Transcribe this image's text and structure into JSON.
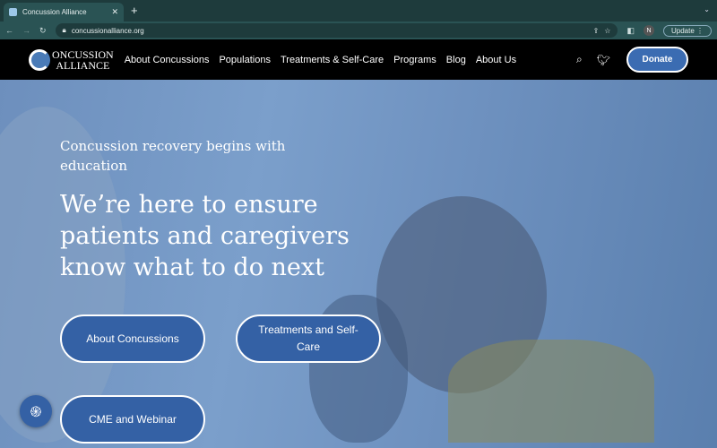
{
  "browser": {
    "tab_title": "Concussion Alliance",
    "url": "concussionalliance.org",
    "profile_initial": "N",
    "update_label": "Update"
  },
  "nav": {
    "logo_line1": "ONCUSSION",
    "logo_line2": "ALLIANCE",
    "items": [
      "About Concussions",
      "Populations",
      "Treatments & Self-Care",
      "Programs",
      "Blog",
      "About Us"
    ],
    "donate_label": "Donate"
  },
  "hero": {
    "subtitle": "Concussion recovery begins with education",
    "headline": "We’re here to ensure patients and caregivers know what to do next",
    "buttons": [
      "About Concussions",
      "Treatments and Self-Care",
      "CME and Webinar"
    ]
  },
  "colors": {
    "accent": "#3461a5",
    "nav_bg": "#000000"
  }
}
